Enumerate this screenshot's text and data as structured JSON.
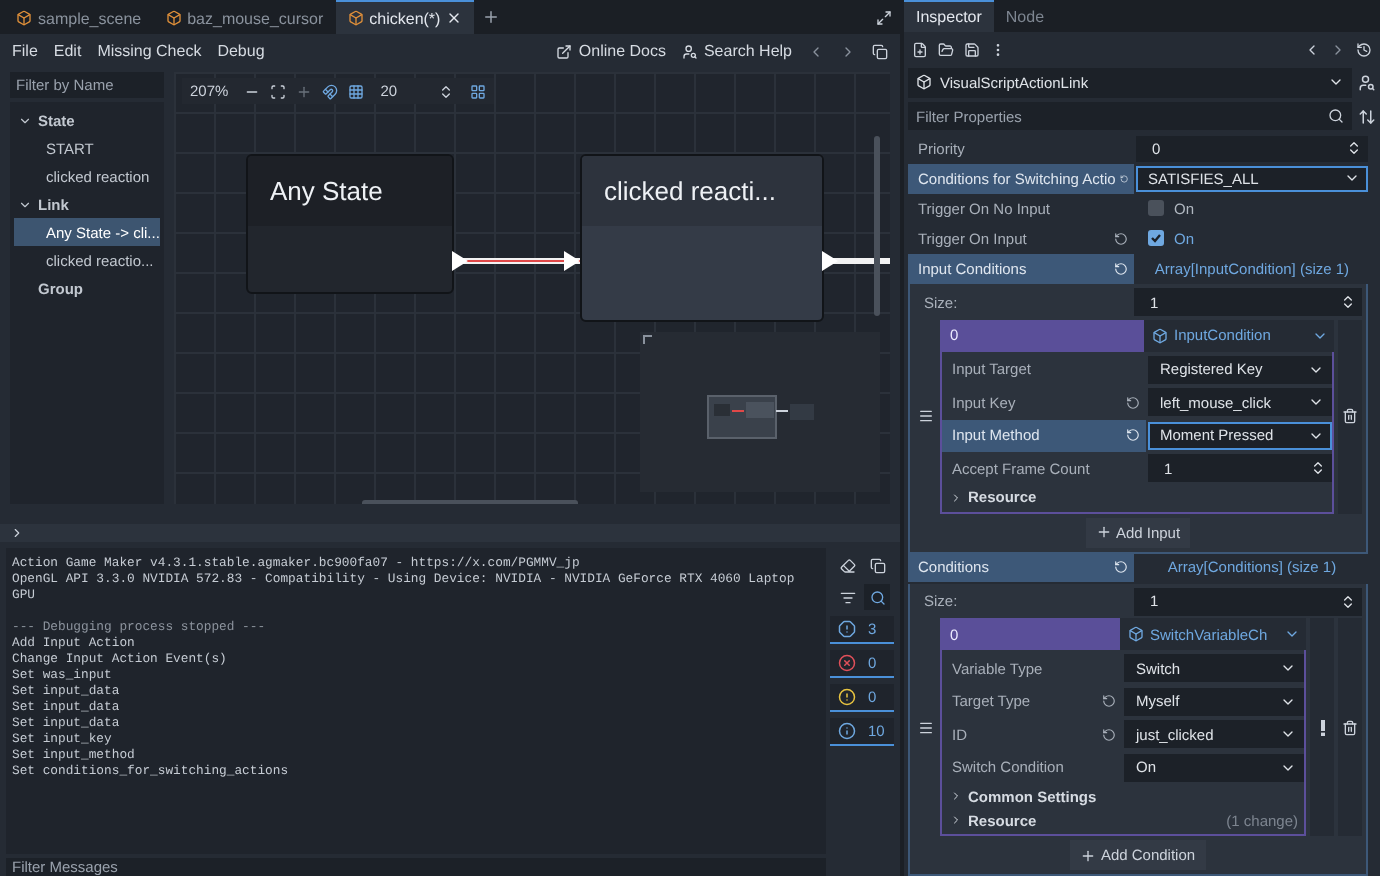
{
  "editor_tabs": [
    {
      "label": "sample_scene",
      "selected": false
    },
    {
      "label": "baz_mouse_cursor",
      "selected": false
    },
    {
      "label": "chicken(*)",
      "selected": true
    }
  ],
  "menu": [
    "File",
    "Edit",
    "Missing Check",
    "Debug"
  ],
  "help_links": [
    "Online Docs",
    "Search Help"
  ],
  "sidebar": {
    "filter_placeholder": "Filter by Name",
    "tree": [
      {
        "label": "State",
        "selected": false,
        "expanded": true,
        "children": [
          {
            "label": "START",
            "selected": false
          },
          {
            "label": "clicked reaction",
            "selected": false
          }
        ]
      },
      {
        "label": "Link",
        "selected": false,
        "expanded": true,
        "children": [
          {
            "label": "Any State -> cli...",
            "selected": true
          },
          {
            "label": "clicked reactio...",
            "selected": false
          }
        ]
      },
      {
        "label": "Group",
        "selected": false
      }
    ]
  },
  "graph": {
    "zoom": "207%",
    "snap_step": "20",
    "nodes": [
      {
        "title": "Any State",
        "kind": "any_state"
      },
      {
        "title": "clicked reacti...",
        "kind": "state"
      }
    ],
    "links": [
      {
        "selected": true
      },
      {
        "selected": false
      }
    ]
  },
  "output": {
    "lines": [
      {
        "text": "Action Game Maker v4.3.1.stable.agmaker.bc900fa07 - https://x.com/PGMMV_jp",
        "kind": "text"
      },
      {
        "text": "OpenGL API 3.3.0 NVIDIA 572.83 - Compatibility - Using Device: NVIDIA - NVIDIA GeForce RTX 4060 Laptop GPU",
        "kind": "text"
      },
      {
        "text": "--- Debugging process stopped ---",
        "kind": "separator"
      },
      {
        "text": "Add Input Action",
        "kind": "text"
      },
      {
        "text": "Change Input Action Event(s)",
        "kind": "text"
      },
      {
        "text": "Set was_input",
        "kind": "text"
      },
      {
        "text": "Set input_data",
        "kind": "text"
      },
      {
        "text": "Set input_data",
        "kind": "text"
      },
      {
        "text": "Set input_data",
        "kind": "text"
      },
      {
        "text": "Set input_key",
        "kind": "text"
      },
      {
        "text": "Set input_method",
        "kind": "text"
      },
      {
        "text": "Set conditions_for_switching_actions",
        "kind": "text"
      }
    ],
    "counters": [
      {
        "kind": "log",
        "count": "3"
      },
      {
        "kind": "error",
        "count": "0"
      },
      {
        "kind": "warning",
        "count": "0"
      },
      {
        "kind": "info",
        "count": "10"
      }
    ],
    "filter_placeholder": "Filter Messages"
  },
  "inspector": {
    "tabs": [
      {
        "label": "Inspector",
        "selected": true
      },
      {
        "label": "Node",
        "selected": false
      }
    ],
    "resource_type": "VisualScriptActionLink",
    "filter_placeholder": "Filter Properties",
    "properties": [
      {
        "kind": "spin",
        "label": "Priority",
        "value": "0",
        "revert": false,
        "focused": false
      },
      {
        "kind": "enum",
        "label": "Conditions for Switching Actio",
        "value": "SATISFIES_ALL",
        "revert": true,
        "focused": true
      },
      {
        "kind": "check",
        "label": "Trigger On No Input",
        "text": "On",
        "checked": false,
        "revert": false,
        "focused": false
      },
      {
        "kind": "check",
        "label": "Trigger On Input",
        "text": "On",
        "checked": true,
        "revert": true,
        "focused": false
      },
      {
        "kind": "array",
        "label": "Input Conditions",
        "value": "Array[InputCondition] (size 1)",
        "revert": true,
        "focused": true,
        "size_label": "Size:",
        "size": "1",
        "add_label": "Add Input",
        "element": {
          "index": "0",
          "type": "InputCondition",
          "warning": false,
          "properties": [
            {
              "kind": "enum",
              "label": "Input Target",
              "value": "Registered Key",
              "revert": false,
              "focused": false
            },
            {
              "kind": "enum",
              "label": "Input Key",
              "value": "left_mouse_click",
              "revert": true,
              "focused": false
            },
            {
              "kind": "enum",
              "label": "Input Method",
              "value": "Moment Pressed",
              "revert": true,
              "focused": true
            },
            {
              "kind": "spin",
              "label": "Accept Frame Count",
              "value": "1",
              "revert": false,
              "focused": false
            }
          ],
          "sections": [
            {
              "label": "Resource"
            }
          ]
        }
      },
      {
        "kind": "array",
        "label": "Conditions",
        "value": "Array[Conditions] (size 1)",
        "revert": true,
        "focused": true,
        "size_label": "Size:",
        "size": "1",
        "add_label": "Add Condition",
        "element": {
          "index": "0",
          "type": "SwitchVariableCh",
          "warning": true,
          "properties": [
            {
              "kind": "enum",
              "label": "Variable Type",
              "value": "Switch",
              "revert": false,
              "focused": false
            },
            {
              "kind": "enum",
              "label": "Target Type",
              "value": "Myself",
              "revert": true,
              "focused": false
            },
            {
              "kind": "enum",
              "label": "ID",
              "value": "just_clicked",
              "revert": true,
              "focused": false
            },
            {
              "kind": "enum",
              "label": "Switch Condition",
              "value": "On",
              "revert": false,
              "focused": false
            }
          ],
          "sections": [
            {
              "label": "Common Settings"
            },
            {
              "label": "Resource",
              "note": "(1 change)"
            }
          ]
        }
      }
    ]
  }
}
